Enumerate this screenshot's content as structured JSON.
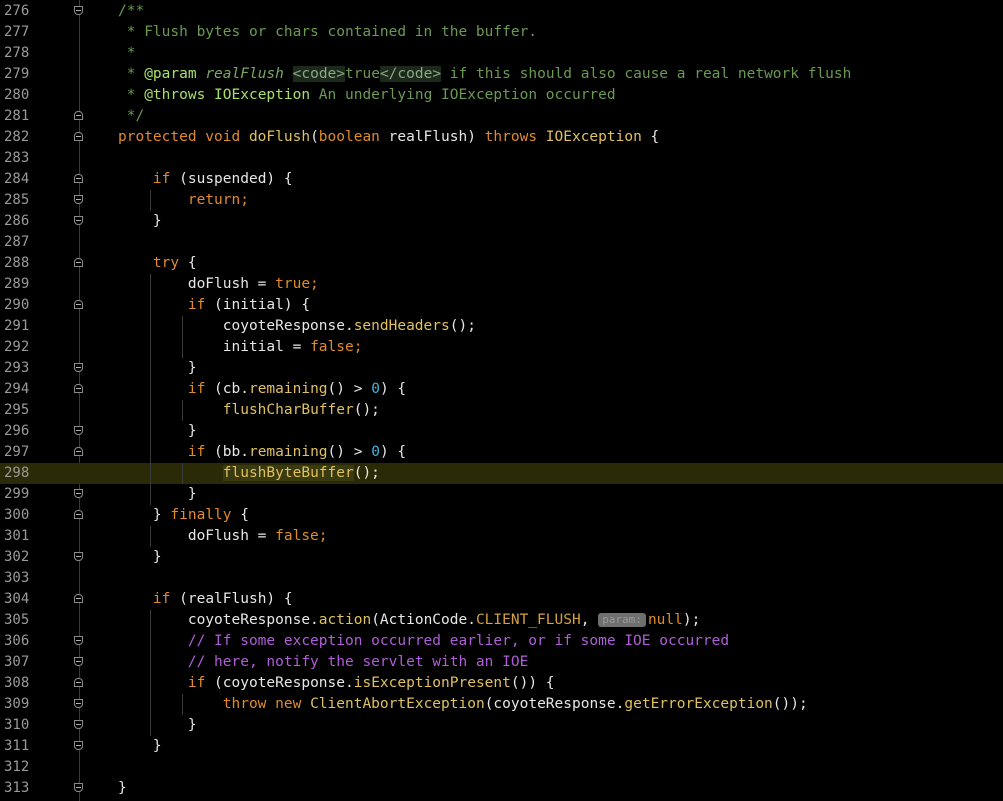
{
  "editor": {
    "colors": {
      "background": "#000000",
      "line_number": "#9a9a9a",
      "keyword": "#e08a2c",
      "method": "#e0c060",
      "number": "#46b4dc",
      "doc_comment": "#6a9a52",
      "line_comment": "#b05ed8",
      "current_line": "#2a2a06"
    },
    "current_line": 298,
    "lines": [
      {
        "no": "276",
        "t": [
          [
            "doc",
            "/**"
          ]
        ]
      },
      {
        "no": "277",
        "t": [
          [
            "doc",
            " * Flush bytes or chars contained in the buffer."
          ]
        ]
      },
      {
        "no": "278",
        "t": [
          [
            "doc",
            " *"
          ]
        ]
      },
      {
        "no": "279",
        "t": [
          [
            "doc",
            " * "
          ],
          [
            "doctag",
            "@param"
          ],
          [
            "doc",
            " "
          ],
          [
            "docparam",
            "realFlush"
          ],
          [
            "doc",
            " "
          ],
          [
            "dochtml",
            "<code>"
          ],
          [
            "doc",
            "true"
          ],
          [
            "dochtml",
            "</code>"
          ],
          [
            "doc",
            " if this should also cause a real network flush"
          ]
        ]
      },
      {
        "no": "280",
        "t": [
          [
            "doc",
            " * "
          ],
          [
            "doctag",
            "@throws"
          ],
          [
            "doc",
            " "
          ],
          [
            "doctag",
            "IOException"
          ],
          [
            "doc",
            " An underlying IOException occurred"
          ]
        ]
      },
      {
        "no": "281",
        "t": [
          [
            "doc",
            " */"
          ]
        ]
      },
      {
        "no": "282",
        "t": [
          [
            "kw",
            "protected void "
          ],
          [
            "fn",
            "doFlush"
          ],
          [
            "id",
            "("
          ],
          [
            "kw",
            "boolean "
          ],
          [
            "id",
            "realFlush) "
          ],
          [
            "kw",
            "throws "
          ],
          [
            "cls",
            "IOException"
          ],
          [
            "id",
            " {"
          ]
        ]
      },
      {
        "no": "283",
        "t": []
      },
      {
        "no": "284",
        "t": [
          [
            "id",
            "    "
          ],
          [
            "kw",
            "if "
          ],
          [
            "id",
            "(suspended) {"
          ]
        ]
      },
      {
        "no": "285",
        "t": [
          [
            "id",
            "        "
          ],
          [
            "kw",
            "return;"
          ]
        ]
      },
      {
        "no": "286",
        "t": [
          [
            "id",
            "    }"
          ]
        ]
      },
      {
        "no": "287",
        "t": []
      },
      {
        "no": "288",
        "t": [
          [
            "id",
            "    "
          ],
          [
            "kw",
            "try "
          ],
          [
            "id",
            "{"
          ]
        ]
      },
      {
        "no": "289",
        "t": [
          [
            "id",
            "        doFlush = "
          ],
          [
            "kw",
            "true;"
          ]
        ]
      },
      {
        "no": "290",
        "t": [
          [
            "id",
            "        "
          ],
          [
            "kw",
            "if "
          ],
          [
            "id",
            "(initial) {"
          ]
        ]
      },
      {
        "no": "291",
        "t": [
          [
            "id",
            "            coyoteResponse."
          ],
          [
            "fn",
            "sendHeaders"
          ],
          [
            "id",
            "();"
          ]
        ]
      },
      {
        "no": "292",
        "t": [
          [
            "id",
            "            initial = "
          ],
          [
            "kw",
            "false;"
          ]
        ]
      },
      {
        "no": "293",
        "t": [
          [
            "id",
            "        }"
          ]
        ]
      },
      {
        "no": "294",
        "t": [
          [
            "id",
            "        "
          ],
          [
            "kw",
            "if "
          ],
          [
            "id",
            "(cb."
          ],
          [
            "fn",
            "remaining"
          ],
          [
            "id",
            "() > "
          ],
          [
            "num",
            "0"
          ],
          [
            "id",
            ") {"
          ]
        ]
      },
      {
        "no": "295",
        "t": [
          [
            "id",
            "            "
          ],
          [
            "fn",
            "flushCharBuffer"
          ],
          [
            "id",
            "();"
          ]
        ]
      },
      {
        "no": "296",
        "t": [
          [
            "id",
            "        }"
          ]
        ]
      },
      {
        "no": "297",
        "t": [
          [
            "id",
            "        "
          ],
          [
            "kw",
            "if "
          ],
          [
            "id",
            "(bb."
          ],
          [
            "fn",
            "remaining"
          ],
          [
            "id",
            "() > "
          ],
          [
            "num",
            "0"
          ],
          [
            "id",
            ") {"
          ]
        ]
      },
      {
        "no": "298",
        "t": [
          [
            "id",
            "            "
          ],
          [
            "hl-call",
            "flushByteBuffer"
          ],
          [
            "id",
            "();"
          ]
        ]
      },
      {
        "no": "299",
        "t": [
          [
            "id",
            "        }"
          ]
        ]
      },
      {
        "no": "300",
        "t": [
          [
            "id",
            "    } "
          ],
          [
            "kw",
            "finally "
          ],
          [
            "id",
            "{"
          ]
        ]
      },
      {
        "no": "301",
        "t": [
          [
            "id",
            "        doFlush = "
          ],
          [
            "kw",
            "false;"
          ]
        ]
      },
      {
        "no": "302",
        "t": [
          [
            "id",
            "    }"
          ]
        ]
      },
      {
        "no": "303",
        "t": []
      },
      {
        "no": "304",
        "t": [
          [
            "id",
            "    "
          ],
          [
            "kw",
            "if "
          ],
          [
            "id",
            "(realFlush) {"
          ]
        ]
      },
      {
        "no": "305",
        "t": [
          [
            "id",
            "        coyoteResponse."
          ],
          [
            "fn",
            "action"
          ],
          [
            "id",
            "(ActionCode."
          ],
          [
            "const",
            "CLIENT_FLUSH"
          ],
          [
            "id",
            ", "
          ],
          [
            "hint",
            "param:"
          ],
          [
            "kw",
            "null"
          ],
          [
            "id",
            ");"
          ]
        ]
      },
      {
        "no": "306",
        "t": [
          [
            "id",
            "        "
          ],
          [
            "com",
            "// If some exception occurred earlier, or if some IOE occurred"
          ]
        ]
      },
      {
        "no": "307",
        "t": [
          [
            "id",
            "        "
          ],
          [
            "com",
            "// here, notify the servlet with an IOE"
          ]
        ]
      },
      {
        "no": "308",
        "t": [
          [
            "id",
            "        "
          ],
          [
            "kw",
            "if "
          ],
          [
            "id",
            "(coyoteResponse."
          ],
          [
            "fn",
            "isExceptionPresent"
          ],
          [
            "id",
            "()) {"
          ]
        ]
      },
      {
        "no": "309",
        "t": [
          [
            "id",
            "            "
          ],
          [
            "kw",
            "throw new "
          ],
          [
            "cls",
            "ClientAbortException"
          ],
          [
            "id",
            "(coyoteResponse."
          ],
          [
            "fn",
            "getErrorException"
          ],
          [
            "id",
            "());"
          ]
        ]
      },
      {
        "no": "310",
        "t": [
          [
            "id",
            "        }"
          ]
        ]
      },
      {
        "no": "311",
        "t": [
          [
            "id",
            "    }"
          ]
        ]
      },
      {
        "no": "312",
        "t": []
      },
      {
        "no": "313",
        "t": [
          [
            "id",
            "}"
          ]
        ]
      }
    ]
  }
}
